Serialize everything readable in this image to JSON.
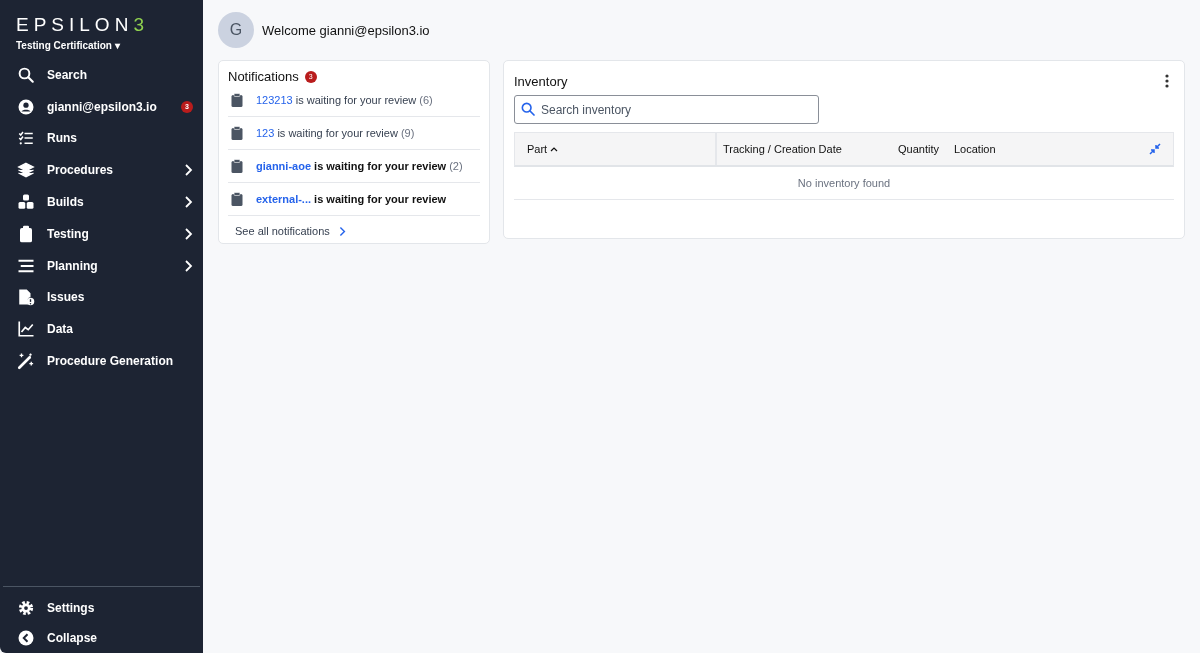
{
  "sidebar": {
    "logo": {
      "main": "EPSILON",
      "accent": "3"
    },
    "workspace": "Testing Certification ▾",
    "items": [
      {
        "kind": "search",
        "label": "Search",
        "has_submenu": false
      },
      {
        "kind": "user",
        "label": "gianni@epsilon3.io",
        "badge": "3",
        "has_submenu": false
      },
      {
        "kind": "checklist",
        "label": "Runs",
        "has_submenu": false
      },
      {
        "kind": "layers",
        "label": "Procedures",
        "has_submenu": true
      },
      {
        "kind": "cubes",
        "label": "Builds",
        "has_submenu": true
      },
      {
        "kind": "clipboard",
        "label": "Testing",
        "has_submenu": true
      },
      {
        "kind": "lines",
        "label": "Planning",
        "has_submenu": true
      },
      {
        "kind": "file-alert",
        "label": "Issues",
        "has_submenu": false
      },
      {
        "kind": "chart",
        "label": "Data",
        "has_submenu": false
      },
      {
        "kind": "wand",
        "label": "Procedure Generation",
        "has_submenu": false
      }
    ],
    "footer": [
      {
        "kind": "gear",
        "label": "Settings"
      },
      {
        "kind": "chevron-circle",
        "label": "Collapse"
      }
    ]
  },
  "header": {
    "avatar": "G",
    "welcome": "Welcome gianni@epsilon3.io"
  },
  "notifications": {
    "title": "Notifications",
    "badge": "3",
    "items": [
      {
        "link": "123213",
        "message": "is waiting for your review",
        "count": "(6)",
        "unread": false
      },
      {
        "link": "123",
        "message": "is waiting for your review",
        "count": "(9)",
        "unread": false
      },
      {
        "link": "gianni-aoe",
        "message": "is waiting for your review",
        "count": "(2)",
        "unread": true
      },
      {
        "link": "external-...",
        "message": "is waiting for your review",
        "unread": true
      }
    ],
    "see_all": "See all notifications"
  },
  "inventory": {
    "title": "Inventory",
    "search": {
      "placeholder": "Search inventory"
    },
    "columns": [
      {
        "label": "Part",
        "sorted": true
      },
      {
        "label": "Tracking / Creation Date"
      },
      {
        "label": "Quantity"
      },
      {
        "label": "Location"
      }
    ],
    "empty": "No inventory found"
  }
}
